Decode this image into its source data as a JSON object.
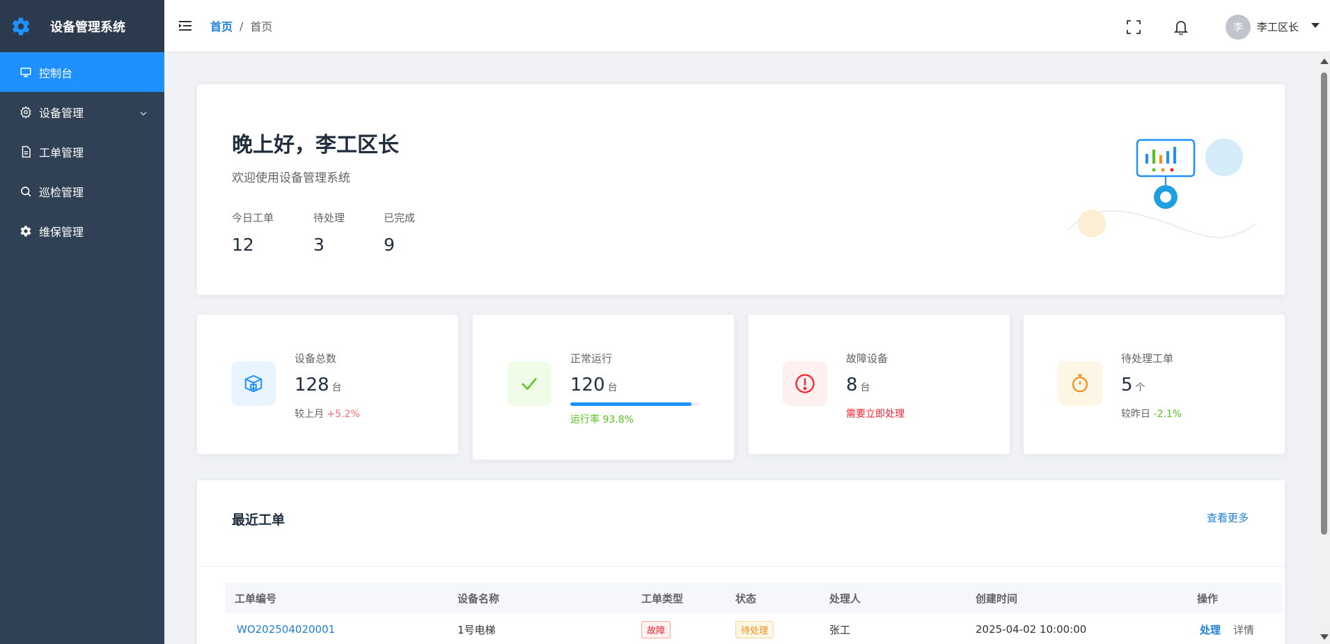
{
  "app": {
    "title": "设备管理系统",
    "logo_icon": "gear-icon",
    "accent_color": "#1e90ff",
    "sidebar_color": "#304156"
  },
  "sidebar": {
    "items": [
      {
        "label": "控制台",
        "icon": "monitor-icon",
        "active": true
      },
      {
        "label": "设备管理",
        "icon": "gear-outline-icon",
        "has_submenu": true
      },
      {
        "label": "工单管理",
        "icon": "document-icon"
      },
      {
        "label": "巡检管理",
        "icon": "search-icon"
      },
      {
        "label": "维保管理",
        "icon": "gear-icon"
      }
    ]
  },
  "header": {
    "breadcrumb": [
      "首页",
      "首页"
    ],
    "breadcrumb_separator": "/",
    "user_avatar_text": "李",
    "user_name": "李工区长"
  },
  "welcome": {
    "greeting": "晚上好，李工区长",
    "subtitle": "欢迎使用设备管理系统",
    "stats": [
      {
        "label": "今日工单",
        "value": "12"
      },
      {
        "label": "待处理",
        "value": "3"
      },
      {
        "label": "已完成",
        "value": "9"
      }
    ]
  },
  "stats": [
    {
      "label": "设备总数",
      "value": "128",
      "unit": "台",
      "sub_prefix": "较上月",
      "sub_value": "+5.2%",
      "icon": "box-icon",
      "color": "#1e90ff"
    },
    {
      "label": "正常运行",
      "value": "120",
      "unit": "台",
      "sub_text": "运行率 93.8%",
      "progress": 0.938,
      "icon": "check-icon",
      "color": "#52c41a"
    },
    {
      "label": "故障设备",
      "value": "8",
      "unit": "台",
      "sub_text": "需要立即处理",
      "icon": "alert-circle-icon",
      "color": "#f5222d"
    },
    {
      "label": "待处理工单",
      "value": "5",
      "unit": "个",
      "sub_prefix": "较昨日",
      "sub_value": "-2.1%",
      "icon": "stopwatch-icon",
      "color": "#fa8c16"
    }
  ],
  "recent_orders": {
    "title": "最近工单",
    "view_more": "查看更多",
    "columns": [
      "工单编号",
      "设备名称",
      "工单类型",
      "状态",
      "处理人",
      "创建时间",
      "操作"
    ],
    "rows": [
      {
        "id": "WO202504020001",
        "device": "1号电梯",
        "type": "故障",
        "status": "待处理",
        "handler": "张工",
        "created": "2025-04-02 10:00:00",
        "actions": [
          "处理",
          "详情"
        ]
      }
    ]
  }
}
